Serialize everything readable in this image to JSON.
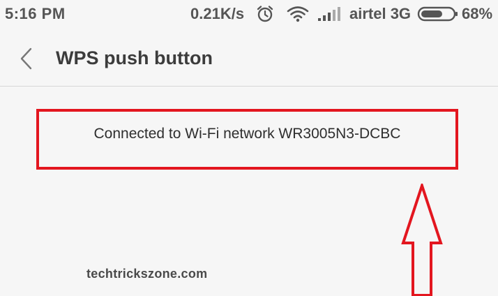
{
  "status_bar": {
    "time": "5:16 PM",
    "network_speed": "0.21K/s",
    "carrier": "airtel 3G",
    "battery_percent": "68%",
    "battery_level": 0.68,
    "icons": [
      "alarm-icon",
      "wifi-icon",
      "signal-icon",
      "battery-icon"
    ]
  },
  "title_bar": {
    "title": "WPS push button",
    "back_icon": "chevron-left-icon"
  },
  "main": {
    "message": "Connected to Wi-Fi network WR3005N3-DCBC",
    "highlight_color": "#e3161f"
  },
  "watermark": {
    "text": "techtrickszone.com"
  },
  "colors": {
    "background": "#f6f6f6",
    "annotation_red": "#e3161f",
    "text": "#333333"
  }
}
